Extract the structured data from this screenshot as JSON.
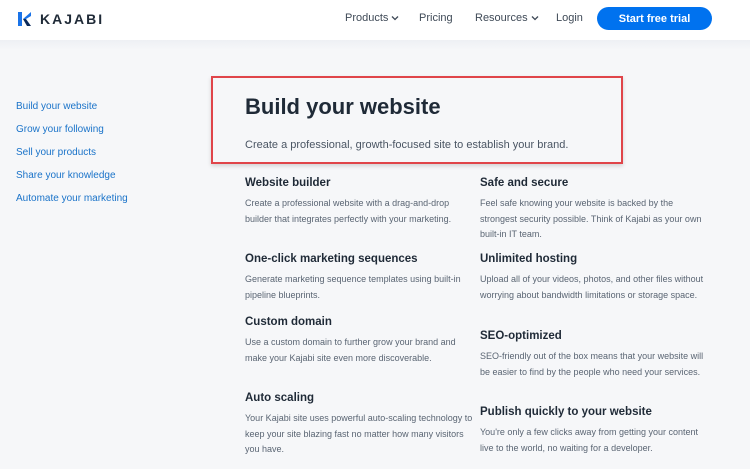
{
  "header": {
    "brand": "KAJABI",
    "nav": [
      {
        "label": "Products",
        "dropdown": true
      },
      {
        "label": "Pricing",
        "dropdown": false
      },
      {
        "label": "Resources",
        "dropdown": true
      },
      {
        "label": "Login",
        "dropdown": false
      }
    ],
    "cta_label": "Start free trial"
  },
  "sidebar": {
    "items": [
      {
        "label": "Build your website"
      },
      {
        "label": "Grow your following"
      },
      {
        "label": "Sell your products"
      },
      {
        "label": "Share your knowledge"
      },
      {
        "label": "Automate your marketing"
      }
    ]
  },
  "hero": {
    "title": "Build your website",
    "subtitle": "Create a professional, growth-focused site to establish your brand."
  },
  "features": {
    "left": [
      {
        "title": "Website builder",
        "body": "Create a professional website with a drag-and-drop builder that integrates perfectly with your marketing."
      },
      {
        "title": "One-click marketing sequences",
        "body": "Generate marketing sequence templates using built-in pipeline blueprints."
      },
      {
        "title": "Custom domain",
        "body": "Use a custom domain to further grow your brand and make your Kajabi site even more discoverable."
      },
      {
        "title": "Auto scaling",
        "body": "Your Kajabi site uses powerful auto-scaling technology to keep your site blazing fast no matter how many visitors you have."
      }
    ],
    "right": [
      {
        "title": "Safe and secure",
        "body": "Feel safe knowing your website is backed by the strongest security possible. Think of Kajabi as your own built-in IT team."
      },
      {
        "title": "Unlimited hosting",
        "body": "Upload all of your videos, photos, and other files without worrying about bandwidth limitations or storage space."
      },
      {
        "title": "SEO-optimized",
        "body": "SEO-friendly out of the box means that your website will be easier to find by the people who need your services."
      },
      {
        "title": "Publish quickly to your website",
        "body": "You're only a few clicks away from getting your content live to the world, no waiting for a developer."
      }
    ]
  },
  "colors": {
    "accent": "#0072ef",
    "link": "#1a73c9",
    "highlight_border": "#e0454a"
  }
}
